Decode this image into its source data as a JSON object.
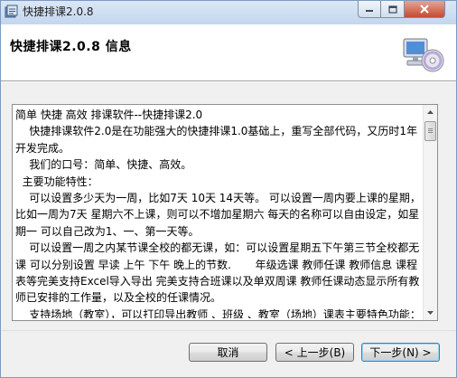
{
  "window": {
    "title": "快捷排课2.0.8"
  },
  "header": {
    "title": "快捷排课2.0.8 信息"
  },
  "info": {
    "paragraphs": [
      "简单 快捷 高效 排课软件--快捷排课2.0",
      "    快捷排课软件2.0是在功能强大的快捷排课1.0基础上，重写全部代码，又历时1年开发完成。",
      "    我们的口号：简单、快捷、高效。",
      "  主要功能特性：",
      "    可以设置多少天为一周，比如7天 10天 14天等。 可以设置一周内要上课的星期，比如一周为7天 星期六不上课，则可以不增加星期六 每天的名称可以自由设定，如星期一 可以自己改为1、一、第一天等。",
      "    可以设置一周之内某节课全校的都无课，如：可以设置星期五下午第三节全校都无课 可以分别设置 早读 上午 下午 晚上的节数.       年级选课 教师任课 教师信息 课程表等完美支持Excel导入导出 完美支持合班课以及单双周课 教师任课动态显示所有教师已安排的工作量，以及全校的任课情况。",
      "    支持场地（教室），可以打印导出教师 、班级 、教室（场地）课表主要特色功能：代课 实际课时统计."
    ]
  },
  "buttons": {
    "cancel": "取消",
    "back": "< 上一步(B)",
    "next": "下一步(N) >"
  },
  "icons": {
    "app": "app-icon",
    "header": "computer-cd-icon"
  },
  "colors": {
    "close_button": "#c44b34",
    "default_button_border": "#3c7fb1"
  }
}
